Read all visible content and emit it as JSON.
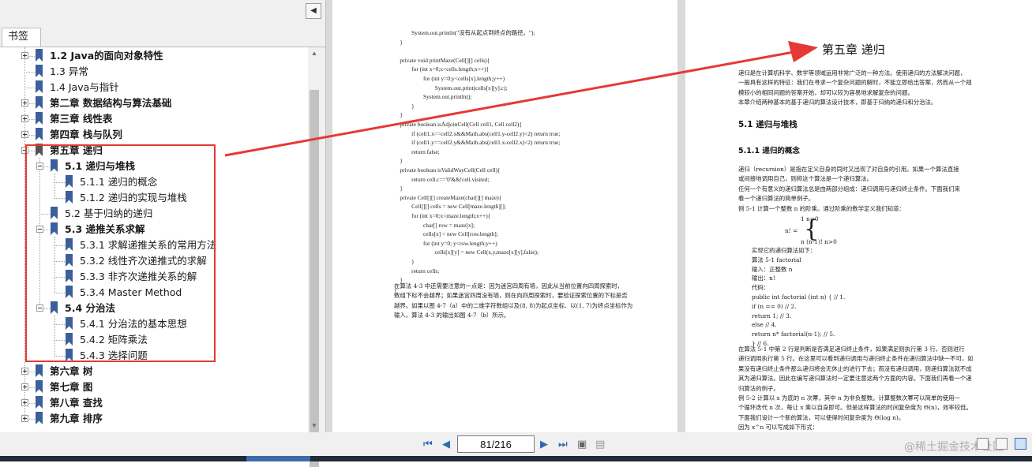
{
  "panel": {
    "collapse_glyph": "◀",
    "tab_label": "书签",
    "bookmarks": [
      {
        "label": "1.2 Java的面向对象特性",
        "level": 0,
        "expander": "plus",
        "bold": true
      },
      {
        "label": "1.3 异常",
        "level": 0,
        "expander": "none",
        "bold": false
      },
      {
        "label": "1.4 Java与指针",
        "level": 0,
        "expander": "none",
        "bold": false
      },
      {
        "label": "第二章 数据结构与算法基础",
        "level": 0,
        "expander": "plus",
        "bold": true
      },
      {
        "label": "第三章 线性表",
        "level": 0,
        "expander": "plus",
        "bold": true
      },
      {
        "label": "第四章 栈与队列",
        "level": 0,
        "expander": "plus",
        "bold": true
      },
      {
        "label": "第五章 递归",
        "level": 0,
        "expander": "minus",
        "bold": true,
        "selected": true
      },
      {
        "label": "5.1 递归与堆栈",
        "level": 1,
        "expander": "minus",
        "bold": true
      },
      {
        "label": "5.1.1 递归的概念",
        "level": 2,
        "expander": "none",
        "bold": false
      },
      {
        "label": "5.1.2 递归的实现与堆栈",
        "level": 2,
        "expander": "none",
        "bold": false
      },
      {
        "label": "5.2 基于归纳的递归",
        "level": 1,
        "expander": "none",
        "bold": false
      },
      {
        "label": "5.3 递推关系求解",
        "level": 1,
        "expander": "minus",
        "bold": true
      },
      {
        "label": "5.3.1 求解递推关系的常用方法",
        "level": 2,
        "expander": "none",
        "bold": false
      },
      {
        "label": "5.3.2 线性齐次递推式的求解",
        "level": 2,
        "expander": "none",
        "bold": false
      },
      {
        "label": "5.3.3 非齐次递推关系的解",
        "level": 2,
        "expander": "none",
        "bold": false
      },
      {
        "label": "5.3.4 Master Method",
        "level": 2,
        "expander": "none",
        "bold": false
      },
      {
        "label": "5.4 分治法",
        "level": 1,
        "expander": "minus",
        "bold": true
      },
      {
        "label": "5.4.1 分治法的基本思想",
        "level": 2,
        "expander": "none",
        "bold": false
      },
      {
        "label": "5.4.2 矩阵乘法",
        "level": 2,
        "expander": "none",
        "bold": false
      },
      {
        "label": "5.4.3 选择问题",
        "level": 2,
        "expander": "none",
        "bold": false
      },
      {
        "label": "第六章 树",
        "level": 0,
        "expander": "plus",
        "bold": true
      },
      {
        "label": "第七章 图",
        "level": 0,
        "expander": "plus",
        "bold": true
      },
      {
        "label": "第八章 查找",
        "level": 0,
        "expander": "plus",
        "bold": true
      },
      {
        "label": "第九章 排序",
        "level": 0,
        "expander": "plus",
        "bold": true
      }
    ]
  },
  "page_left": {
    "code_lines": [
      "            System.out.println(\"没有从起点到终点的路径。\");",
      "    }",
      "",
      "    private void printMaze(Cell[][] cells){",
      "            for (int x=0;x<cells.length;x++){",
      "                    for (int y=0;y<cells[x].length;y++)",
      "                            System.out.print(cells[x][y].c);",
      "                    System.out.println();",
      "            }",
      "    }",
      "    private boolean isAdjoinCell(Cell cell1, Cell cell2){",
      "            if (cell1.x==cell2.x&&Math.abs(cell1.y-cell2.y)<2) return true;",
      "            if (cell1.y==cell2.y&&Math.abs(cell1.x-cell2.x)<2) return true;",
      "            return false;",
      "    }",
      "    private boolean isValidWayCell(Cell cell){",
      "            return cell.c=='0'&&!cell.visited;",
      "    }",
      "    private Cell[][] createMaze(char[][] maze){",
      "            Cell[][] cells = new Cell[maze.length][];",
      "            for (int x=0;x<maze.length;x++){",
      "                    char[] row = maze[x];",
      "                    cells[x] = new Cell[row.length];",
      "                    for (int y=0; y<row.length;y++)",
      "                            cells[x][y] = new Cell(x,y,maze[x][y],false);",
      "            }",
      "            return cells;",
      "    }",
      "}"
    ],
    "paragraph": [
      "      在算法 4-3 中还需要注意的一点是：因为迷宫四周有墙，因此从当前位置向四周探索时，",
      "数组下标不会越界；如果迷宫四周没有墙，则在向四周探索时，要验证探索位置的下标是否",
      "越界。如果以图 4-7（a）中的二维字符数组以及(8, 8)为起点坐标、以(1, 7)为终点坐标作为",
      "输入，算法 4-3 的输出如图 4-7（b）所示。"
    ]
  },
  "page_right": {
    "chapter_title": "第五章    递归",
    "intro": [
      "      递归是在计算机科学、数学等领域运用非常广泛的一种方法。使用递归的方法解决问题，",
      "一般具有这样的特征：我们在寻求一个复杂问题的解时，不能立即给出答案，然而从一个规",
      "模较小的相同问题的答案开始，却可以较为容易地求解复杂的问题。",
      "      本章介绍两种基本的基于递归的算法设计技术，即基于归纳的递归和分治法。"
    ],
    "section": "5.1  递归与堆栈",
    "subsection": "5.1.1  递归的概念",
    "body": [
      "      递归（recursion）是指在定义自身的同时又出现了对自身的引用。如果一个算法直接",
      "或间接地调用自己，则称这个算法是一个递归算法。",
      "      任何一个有意义的递归算法总是由两部分组成：递归调用与递归终止条件。下面我们来",
      "看一个递归算法的简单例子。",
      "      例 5-1      计算一个整数 n 的阶乘。通过阶乘的数学定义我们知道："
    ],
    "formula": [
      "1            n=0",
      "n!  =",
      "n (n-1)!    n>0"
    ],
    "algo": [
      "实现它的递归算法如下：",
      "算法 5-1  factorial",
      "输入：正整数 n",
      "输出：n!",
      "代码：",
      "        public int factorial (int n) {                              // 1.",
      "                if (n == 0)                                         // 2.",
      "                        return 1;                                   // 3.",
      "                else                                                // 4.",
      "                        return n* factorial(n-1);                   // 5.",
      "        }                                                           // 6."
    ],
    "tail": [
      "      在算法 5-1 中第 2 行是判断是否满足递归终止条件，如果满足则执行第 3 行，否则进行",
      "递归调用执行第 5 行。在这里可以看到递归调用与递归终止条件在递归算法中缺一不可，如",
      "果没有递归终止条件那么递归将会无休止的进行下去；而没有递归调用，则递归算法就不成",
      "其为递归算法。因此在编写递归算法时一定要注意这两个方面的内容。下面我们再看一个递",
      "归算法的例子。",
      "      例 5-2      计算以 x 为底的 n 次幂，其中 n 为非负整数。计算整数次幂可以简单的使用一",
      "个循环迭代 n 次，每让 x 乘以自身即可。但是这样算法的时间复杂度为 Θ(n)，效率较低。",
      "下面我们设计一个新的算法，可以使得时间复杂度为 Θ(log n)。",
      "      因为 x^n 可以写成如下形式："
    ]
  },
  "navigation": {
    "first_glyph": "⏮",
    "prev_glyph": "◀",
    "next_glyph": "▶",
    "last_glyph": "⏭",
    "page_indicator": "81/216"
  },
  "watermark": "@稀土掘金技术社区",
  "colors": {
    "annotation_red": "#e53935",
    "bookmark_blue": "#3a5f9b",
    "nav_blue": "#2b6ab3"
  }
}
